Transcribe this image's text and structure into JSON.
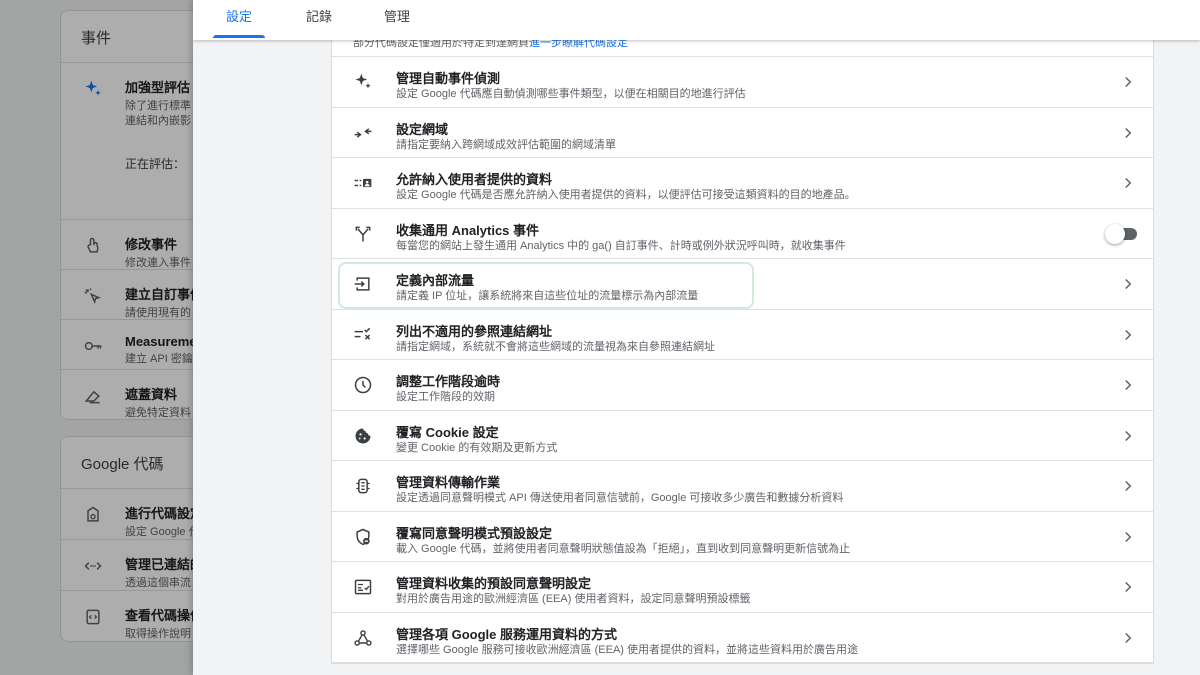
{
  "background": {
    "events_card": {
      "title": "事件",
      "items": [
        {
          "title": "加強型評估",
          "sub1": "除了進行標準",
          "sub2": "連結和內嵌影",
          "evaluating": "正在評估："
        },
        {
          "title": "修改事件",
          "sub": "修改連入事件"
        },
        {
          "title": "建立自訂事件",
          "sub": "請使用現有的"
        },
        {
          "title": "Measureme",
          "sub": "建立 API 密鑰"
        },
        {
          "title": "遮蓋資料",
          "sub": "避免特定資料"
        }
      ]
    },
    "tag_card": {
      "title": "Google 代碼",
      "items": [
        {
          "title": "進行代碼設定",
          "sub": "設定 Google 代"
        },
        {
          "title": "管理已連結的",
          "sub": "透過這個串流"
        },
        {
          "title": "查看代碼操作",
          "sub": "取得操作說明"
        }
      ]
    }
  },
  "tabs": [
    {
      "label": "設定",
      "active": true
    },
    {
      "label": "記錄",
      "active": false
    },
    {
      "label": "管理",
      "active": false
    }
  ],
  "peek_text": "部分代碼設定僅適用於特定到達網頁",
  "peek_link": "進一步瞭解代碼設定",
  "settings": [
    {
      "icon": "sparkle-icon",
      "title": "管理自動事件偵測",
      "sub": "設定 Google 代碼應自動偵測哪些事件類型，以便在相關目的地進行評估",
      "control": "chevron"
    },
    {
      "icon": "merge-arrows-icon",
      "title": "設定網域",
      "sub": "請指定要納入跨網域成效評估範圍的網域清單",
      "control": "chevron"
    },
    {
      "icon": "user-data-icon",
      "title": "允許納入使用者提供的資料",
      "sub": "設定 Google 代碼是否應允許納入使用者提供的資料，以便評估可接受這類資料的目的地產品。",
      "control": "chevron"
    },
    {
      "icon": "fork-icon",
      "title": "收集通用 Analytics 事件",
      "sub": "每當您的網站上發生通用 Analytics 中的 ga() 自訂事件、計時或例外狀況呼叫時，就收集事件",
      "control": "toggle",
      "toggle_on": false
    },
    {
      "icon": "login-icon",
      "title": "定義內部流量",
      "sub": "請定義 IP 位址，讓系統將來自這些位址的流量標示為內部流量",
      "control": "chevron",
      "highlighted": true
    },
    {
      "icon": "list-exclude-icon",
      "title": "列出不適用的參照連結網址",
      "sub": "請指定網域，系統就不會將這些網域的流量視為來自參照連結網址",
      "control": "chevron"
    },
    {
      "icon": "clock-icon",
      "title": "調整工作階段逾時",
      "sub": "設定工作階段的效期",
      "control": "chevron"
    },
    {
      "icon": "cookie-icon",
      "title": "覆寫 Cookie 設定",
      "sub": "變更 Cookie 的有效期及更新方式",
      "control": "chevron"
    },
    {
      "icon": "data-transfer-icon",
      "title": "管理資料傳輸作業",
      "sub": "設定透過同意聲明模式 API 傳送使用者同意信號前，Google 可接收多少廣告和數據分析資料",
      "control": "chevron"
    },
    {
      "icon": "consent-shield-icon",
      "title": "覆寫同意聲明模式預設設定",
      "sub": "載入 Google 代碼，並將使用者同意聲明狀態值設為「拒絕」，直到收到同意聲明更新信號為止",
      "control": "chevron"
    },
    {
      "icon": "checklist-icon",
      "title": "管理資料收集的預設同意聲明設定",
      "sub": "對用於廣告用途的歐洲經濟區 (EEA) 使用者資料，設定同意聲明預設標籤",
      "control": "chevron"
    },
    {
      "icon": "hub-icon",
      "title": "管理各項 Google 服務運用資料的方式",
      "sub": "選擇哪些 Google 服務可接收歐洲經濟區 (EEA) 使用者提供的資料，並將這些資料用於廣告用途",
      "control": "chevron"
    }
  ]
}
